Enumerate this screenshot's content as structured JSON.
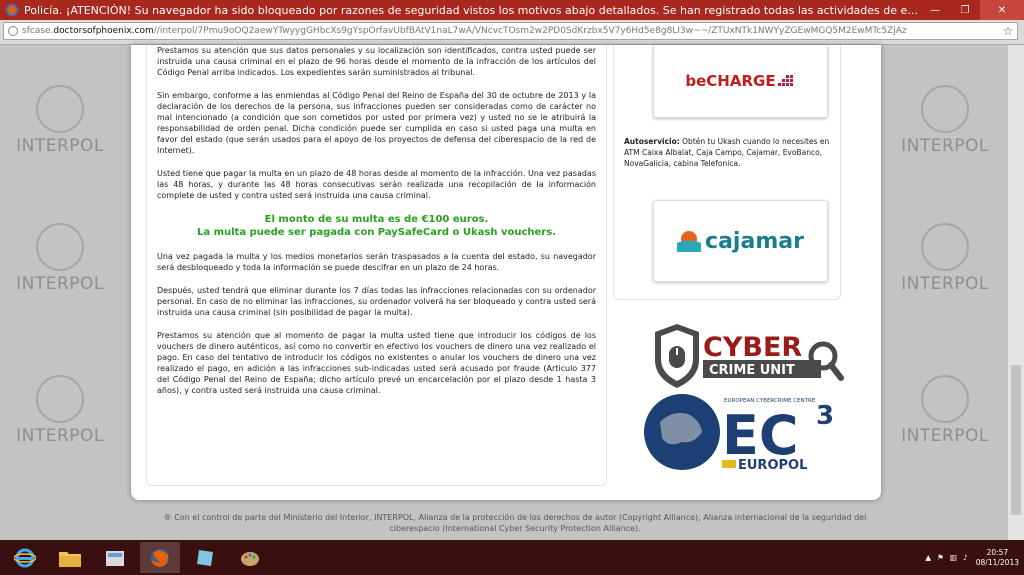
{
  "window": {
    "title": "Policía. ¡ATENCIÓN! Su navegador ha sido bloqueado por razones de seguridad vistos los motivos abajo detallados. Se han registrado todas las actividades de este equipo. Todos los archi...",
    "minimize": "—",
    "maximize": "❐",
    "close": "✕"
  },
  "address": {
    "prefix": "sfcase.",
    "domain": "doctorsofphoenix.com",
    "path": "//interpol/7Pmu9oOQ2aewYTwyygGHbcXs9gYspOrfavUbfBAtV1naL7wA/VNcvcTOsm2w2PD0SdKrzbx5V7y6Hd5e8g8LI3w~~/ZTUxNTk1NWYyZGEwMGQ5M2EwMTc5ZjAz"
  },
  "sidebar": {
    "watermark": "INTERPOL"
  },
  "main": {
    "p1": "Prestamos su atención que sus datos personales y su localización son identificados, contra usted puede ser instruida una causa criminal en el plazo de 96 horas desde el momento de la infracción de los artículos del Código Penal arriba indicados. Los expedientes sarán suministrados al tribunal.",
    "p2": "Sin embargo, conforme a las enmiendas al Código Penal del Reino de España del 30 de octubre de 2013 y la declaración de los derechos de la persona, sus infracciones pueden ser consideradas como de carácter no mal intencionado (a condición que son cometidos por usted por primera vez) y usted no se le atribuirá la responsabilidad de orden penal. Dicha condición puede ser cumplida en caso si usted paga una multa en favor del estado (que serán usados para el apoyo de los proyectos de defensa del ciberespacio de la red de Internet).",
    "p3": "Usted tiene que pagar la multa en un plazo de 48 horas desde al momento de la infracción. Una vez pasadas las 48 horas, y durante las 48 horas consecutivas serán realizada una recopilación de la información complete de usted y contra usted será instruida una causa criminal.",
    "fine_line1": "El monto de su multa es de €100 euros.",
    "fine_line2": "La multa puede ser pagada con PaySafeCard o Ukash vouchers.",
    "p4": "Una vez pagada la multa y los medios monetarios serán traspasados a la cuenta del estado, su navegador será desbloqueado y toda la información se puede descifrar en un plazo de 24 horas.",
    "p5": "Después, usted tendrá que eliminar durante los 7 días todas las infracciones relacionadas con su ordenador personal. En caso de no eliminar las infracciones, su ordenador volverá ha ser bloqueado y contra usted será instruida una causa criminal (sin posibilidad de pagar la multa).",
    "p6": "Prestamos su atención que al momento de pagar la multa usted tiene que introducir los códigos de los vouchers de dinero auténticos, así como no convertir en efectivo los vouchers de dinero una vez realizado el pago. En caso del tentativo de introducir los códigos no existentes o anular los vouchers de dinero una vez realizado el pago, en adición a las infracciones sub-indicadas usted será acusado por fraude (Articulo 377 del Código Penal del Reino de España; dicho artículo prevé un encarcelación por el plazo desde 1 hasta 3 años), y contra usted será instruida una causa criminal."
  },
  "right": {
    "becharge": "beCHARGE",
    "auto_label": "Autoservicio:",
    "auto_text": "Obtén tu Ukash cuando lo necesites en ATM Caixa Albalat, Caja Campo, Cajamar, EvoBanco, NovaGalicia, cabina Telefonica.",
    "cajamar": "cajamar",
    "cyber_line1": "CYBER",
    "cyber_line2": "CRIME UNIT",
    "ec3_top": "EUROPEAN CYBERCRIME CENTRE",
    "ec3_text": "EC",
    "ec3_sup": "3",
    "europol": "EUROPOL"
  },
  "footer": {
    "text": "® Con el control de parte del Ministerio del Interior, INTERPOL, Alianza de la protección de los derechos de autor (Copyright Alliance), Alianza internacional de la seguridad del ciberespacio (International Cyber Security Protection Alliance)."
  },
  "taskbar": {
    "time": "20:57",
    "date": "08/11/2013"
  },
  "colors": {
    "titlebar": "#a8281e",
    "green": "#2aa020",
    "taskbar": "#3a0f0f"
  }
}
